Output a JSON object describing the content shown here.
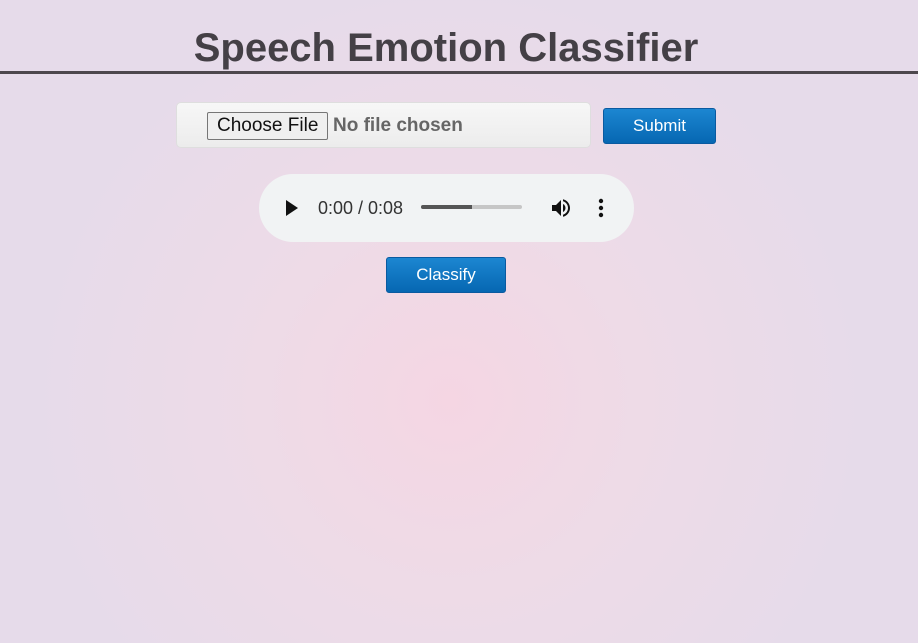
{
  "header": {
    "title": "Speech Emotion Classifier"
  },
  "upload": {
    "choose_label": "Choose File",
    "status_text": "No file chosen",
    "submit_label": "Submit"
  },
  "audio": {
    "time_display": "0:00 / 0:08",
    "buffered_fraction": 0.5,
    "icons": [
      "play-icon",
      "volume-icon",
      "more-options-icon"
    ]
  },
  "actions": {
    "classify_label": "Classify"
  },
  "colors": {
    "accent_button": "#0a72bf",
    "title_text": "#444046"
  }
}
